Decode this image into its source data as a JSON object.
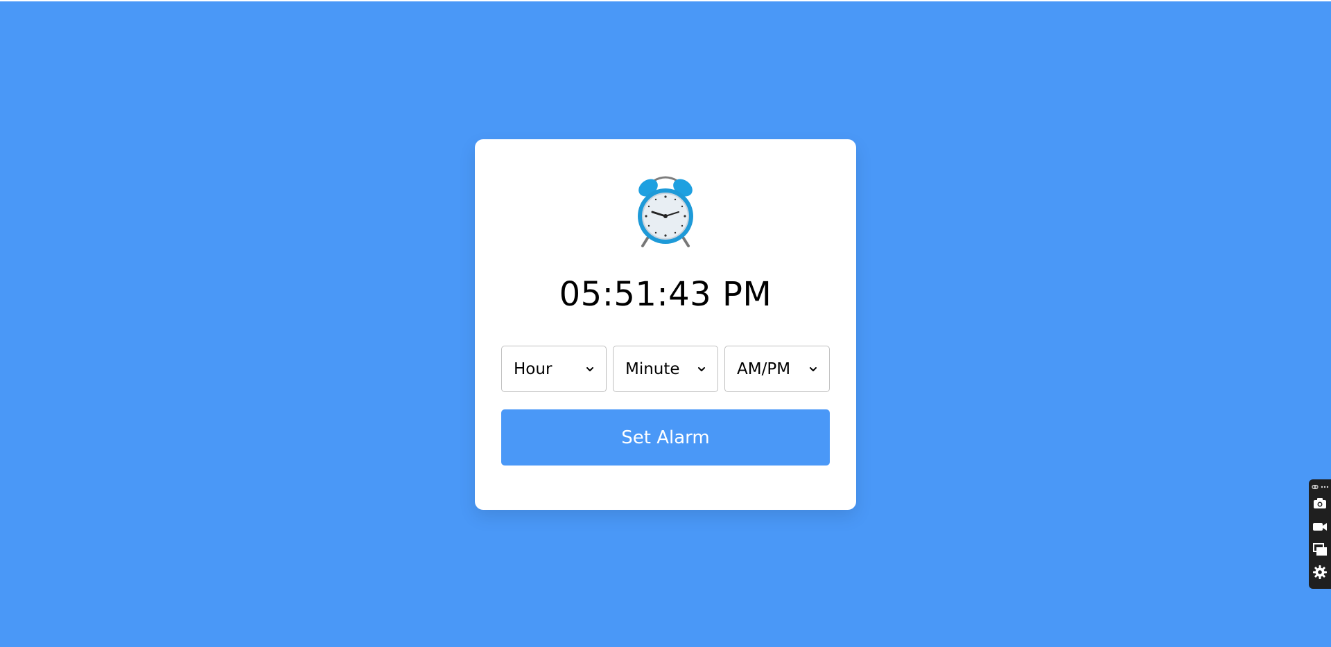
{
  "app": {
    "current_time": "05:51:43 PM",
    "clock_icon": "alarm-clock-icon"
  },
  "selects": {
    "hour": {
      "selected": "Hour"
    },
    "minute": {
      "selected": "Minute"
    },
    "ampm": {
      "selected": "AM/PM"
    }
  },
  "actions": {
    "set_alarm_label": "Set Alarm"
  },
  "toolbar": {
    "items": [
      "link-icon",
      "more-icon",
      "camera-icon",
      "video-icon",
      "windows-icon",
      "gear-icon"
    ]
  },
  "colors": {
    "background": "#4a98f7",
    "card": "#ffffff",
    "button": "#4a98f7",
    "toolbar": "#1f1f1f"
  }
}
